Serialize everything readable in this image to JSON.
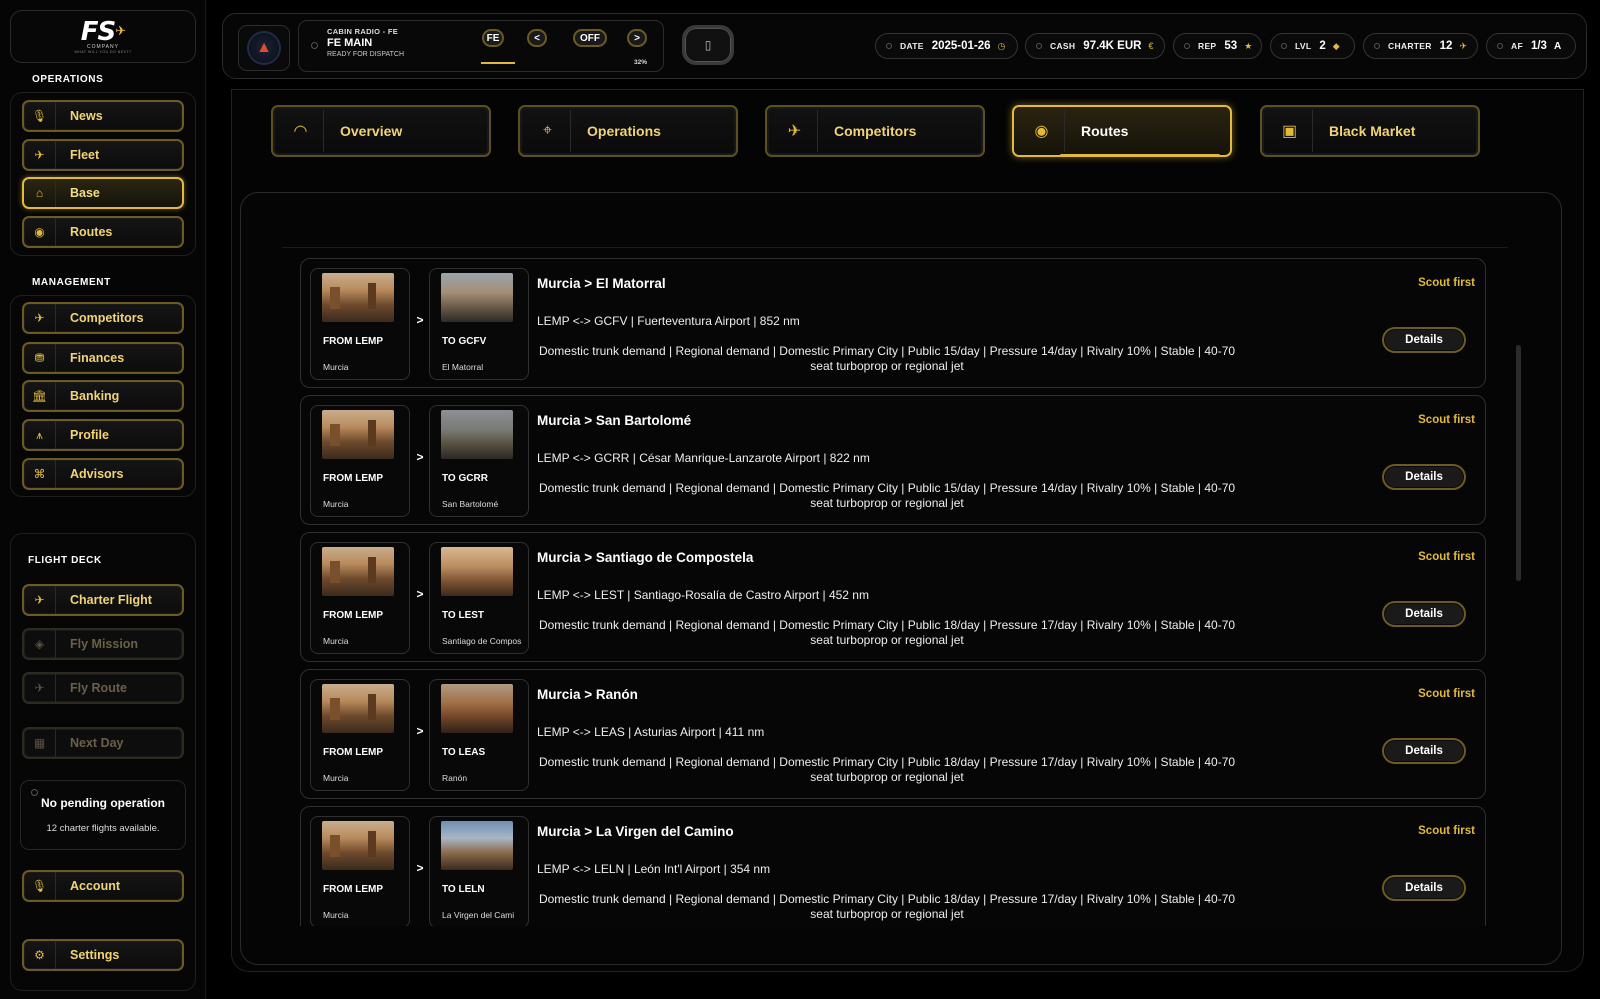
{
  "sidebar": {
    "logo": {
      "main": "FS",
      "sub": "COMPANY",
      "tagline": "WHAT WILL YOU DO NEXT?"
    },
    "operations_title": "OPERATIONS",
    "operations": [
      {
        "label": "News",
        "icon": "microphone-icon"
      },
      {
        "label": "Fleet",
        "icon": "airplane-icon"
      },
      {
        "label": "Base",
        "icon": "hangar-icon",
        "active": true
      },
      {
        "label": "Routes",
        "icon": "globe-icon"
      }
    ],
    "management_title": "MANAGEMENT",
    "management": [
      {
        "label": "Competitors",
        "icon": "competitor-plane-icon"
      },
      {
        "label": "Finances",
        "icon": "coins-icon"
      },
      {
        "label": "Banking",
        "icon": "bank-icon"
      },
      {
        "label": "Profile",
        "icon": "wings-icon"
      },
      {
        "label": "Advisors",
        "icon": "advisor-icon"
      }
    ],
    "flight_deck_title": "FLIGHT DECK",
    "flight_deck": [
      {
        "label": "Charter Flight",
        "icon": "airplane-icon"
      },
      {
        "label": "Fly Mission",
        "icon": "target-icon",
        "disabled": true
      },
      {
        "label": "Fly Route",
        "icon": "takeoff-icon",
        "disabled": true
      },
      {
        "label": "Next Day",
        "icon": "calendar-icon",
        "disabled": true
      }
    ],
    "pending": {
      "title": "No pending operation",
      "subtitle": "12 charter flights available."
    },
    "account_label": "Account",
    "settings_label": "Settings"
  },
  "header": {
    "radio": {
      "line1": "CABIN RADIO - FE",
      "line2": "FE MAIN",
      "line3": "READY FOR DISPATCH",
      "fe_label": "FE",
      "prev_label": "<",
      "off_label": "OFF",
      "next_label": ">",
      "volume": "32%"
    },
    "phone_icon": "phone-icon",
    "stats": {
      "date_label": "DATE",
      "date_value": "2025-01-26",
      "cash_label": "CASH",
      "cash_value": "97.4K EUR",
      "cash_icon": "€",
      "rep_label": "REP",
      "rep_value": "53",
      "rep_icon": "★",
      "lvl_label": "LVL",
      "lvl_value": "2",
      "lvl_icon": "◆",
      "charter_label": "CHARTER",
      "charter_value": "12",
      "charter_icon": "✈",
      "af_label": "AF",
      "af_value": "1/3",
      "af_icon": "A"
    }
  },
  "tabs": [
    {
      "label": "Overview",
      "icon": "gauge-icon"
    },
    {
      "label": "Operations",
      "icon": "crosshair-icon"
    },
    {
      "label": "Competitors",
      "icon": "competitor-plane-icon"
    },
    {
      "label": "Routes",
      "icon": "globe-icon",
      "active": true
    },
    {
      "label": "Black Market",
      "icon": "briefcase-icon"
    }
  ],
  "routes": [
    {
      "title": "Murcia > El Matorral",
      "from_label": "FROM LEMP",
      "from_city": "Murcia",
      "to_label": "TO GCFV",
      "to_city": "El Matorral",
      "info": "LEMP <-> GCFV | Fuerteventura Airport | 852 nm",
      "desc": "Domestic trunk demand | Regional demand | Domestic Primary City | Public 15/day | Pressure 14/day | Rivalry 10% | Stable | 40-70 seat turboprop or regional jet",
      "status": "Scout first",
      "details_label": "Details"
    },
    {
      "title": "Murcia > San Bartolomé",
      "from_label": "FROM LEMP",
      "from_city": "Murcia",
      "to_label": "TO GCRR",
      "to_city": "San Bartolomé",
      "info": "LEMP <-> GCRR | César Manrique-Lanzarote Airport | 822 nm",
      "desc": "Domestic trunk demand | Regional demand | Domestic Primary City | Public 15/day | Pressure 14/day | Rivalry 10% | Stable | 40-70 seat turboprop or regional jet",
      "status": "Scout first",
      "details_label": "Details"
    },
    {
      "title": "Murcia > Santiago de Compostela",
      "from_label": "FROM LEMP",
      "from_city": "Murcia",
      "to_label": "TO LEST",
      "to_city": "Santiago de Compos",
      "info": "LEMP <-> LEST | Santiago-Rosalía de Castro Airport | 452 nm",
      "desc": "Domestic trunk demand | Regional demand | Domestic Primary City | Public 18/day | Pressure 17/day | Rivalry 10% | Stable | 40-70 seat turboprop or regional jet",
      "status": "Scout first",
      "details_label": "Details"
    },
    {
      "title": "Murcia > Ranón",
      "from_label": "FROM LEMP",
      "from_city": "Murcia",
      "to_label": "TO LEAS",
      "to_city": "Ranón",
      "info": "LEMP <-> LEAS | Asturias Airport | 411 nm",
      "desc": "Domestic trunk demand | Regional demand | Domestic Primary City | Public 18/day | Pressure 17/day | Rivalry 10% | Stable | 40-70 seat turboprop or regional jet",
      "status": "Scout first",
      "details_label": "Details"
    },
    {
      "title": "Murcia > La Virgen del Camino",
      "from_label": "FROM LEMP",
      "from_city": "Murcia",
      "to_label": "TO LELN",
      "to_city": "La Virgen del Cami",
      "info": "LEMP <-> LELN | León Int'l Airport | 354 nm",
      "desc": "Domestic trunk demand | Regional demand | Domestic Primary City | Public 18/day | Pressure 17/day | Rivalry 10% | Stable | 40-70 seat turboprop or regional jet",
      "status": "Scout first",
      "details_label": "Details"
    }
  ]
}
